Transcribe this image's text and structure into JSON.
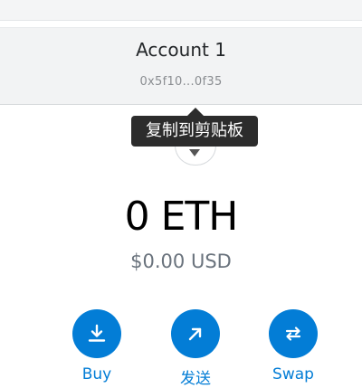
{
  "account": {
    "name": "Account 1",
    "address": "0x5f10...0f35"
  },
  "tooltip": {
    "text": "复制到剪贴板"
  },
  "balance": {
    "primary": "0 ETH",
    "fiat": "$0.00 USD"
  },
  "actions": [
    {
      "label": "Buy",
      "icon": "download-icon"
    },
    {
      "label": "发送",
      "icon": "arrow-up-right-icon"
    },
    {
      "label": "Swap",
      "icon": "swap-icon"
    }
  ],
  "colors": {
    "accent": "#037dd6",
    "tooltip_bg": "#2c2c2c",
    "panel_bg": "#f2f3f4"
  }
}
